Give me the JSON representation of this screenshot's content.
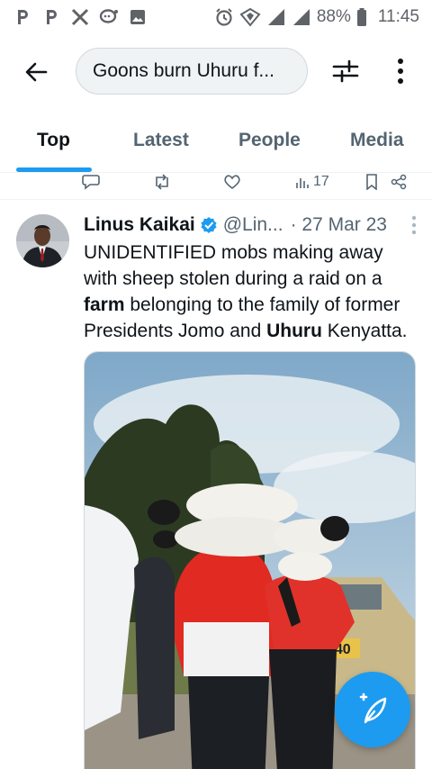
{
  "status_bar": {
    "left_icons": [
      "p-app-icon",
      "p-app-icon",
      "x-app-icon",
      "chat-bubble-icon",
      "image-icon"
    ],
    "battery": "88%",
    "time": "11:45"
  },
  "search": {
    "query": "Goons burn Uhuru f..."
  },
  "tabs": [
    {
      "label": "Top",
      "active": true
    },
    {
      "label": "Latest",
      "active": false
    },
    {
      "label": "People",
      "active": false
    },
    {
      "label": "Media",
      "active": false
    }
  ],
  "previous_tweet": {
    "views": "17"
  },
  "tweet": {
    "author": "Linus Kaikai",
    "verified": true,
    "handle": "@Lin...",
    "date": "· 27 Mar 23",
    "text_segments": [
      {
        "text": "UNIDENTIFIED mobs making away with sheep stolen during a raid on a ",
        "bold": false
      },
      {
        "text": "farm",
        "bold": true
      },
      {
        "text": " belonging to the family of former Presidents Jomo and ",
        "bold": false
      },
      {
        "text": "Uhuru",
        "bold": true
      },
      {
        "text": " Kenyatta.",
        "bold": false
      }
    ],
    "media_plate": "N 440"
  },
  "colors": {
    "accent": "#1d9bf0",
    "text_primary": "#0f1419",
    "text_secondary": "#536471",
    "search_bg": "#eff3f4"
  }
}
